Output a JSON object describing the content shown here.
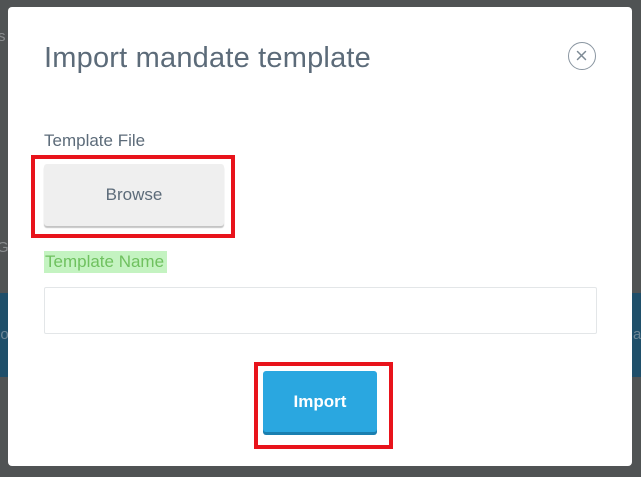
{
  "dialog": {
    "title": "Import mandate template",
    "close_icon": "close-circle-icon"
  },
  "form": {
    "template_file_label": "Template File",
    "browse_label": "Browse",
    "template_name_label": "Template Name",
    "template_name_value": "",
    "template_name_placeholder": "",
    "import_label": "Import"
  },
  "background": {
    "left_glyph_top": "s",
    "left_glyph_mid": "G",
    "left_glyph_band": "ho",
    "right_glyph_band": "a"
  },
  "colors": {
    "accent": "#2aa7e0",
    "highlight": "#e8131b",
    "label_highlight_bg": "#c4f3c1",
    "label_highlight_text": "#6fc15f"
  }
}
